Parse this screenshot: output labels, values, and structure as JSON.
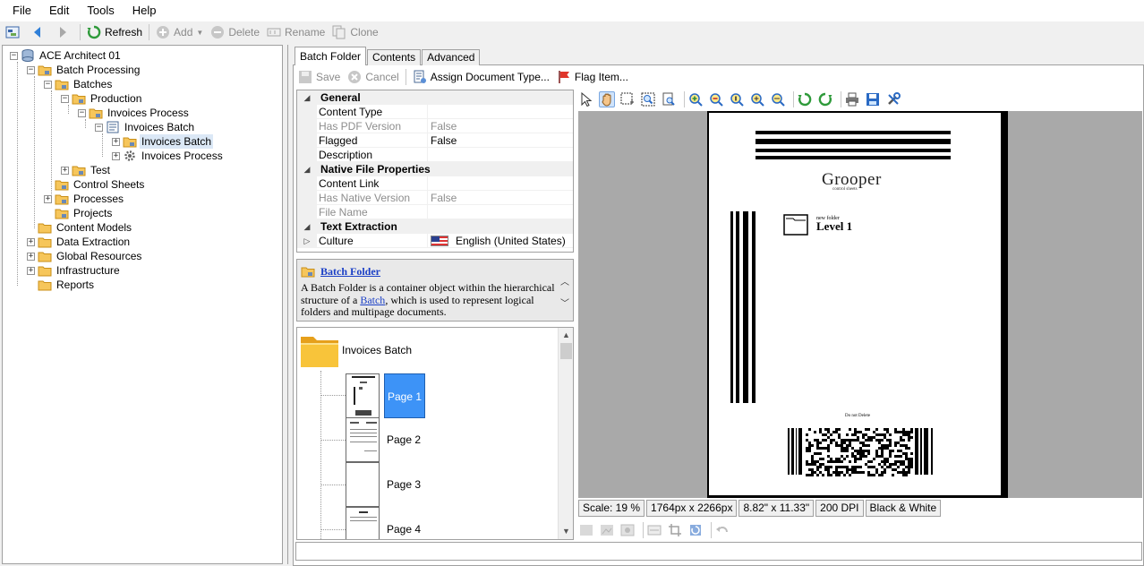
{
  "menu": [
    "File",
    "Edit",
    "Tools",
    "Help"
  ],
  "main_toolbar": {
    "refresh": "Refresh",
    "add": "Add",
    "delete": "Delete",
    "rename": "Rename",
    "clone": "Clone"
  },
  "tree": {
    "root": "ACE Architect 01",
    "batch_processing": "Batch Processing",
    "batches": "Batches",
    "production": "Production",
    "invoices_process_folder": "Invoices Process",
    "invoices_batch_node": "Invoices Batch",
    "invoices_batch_selected": "Invoices Batch",
    "invoices_process_item": "Invoices Process",
    "test": "Test",
    "control_sheets": "Control Sheets",
    "processes": "Processes",
    "projects": "Projects",
    "content_models": "Content Models",
    "data_extraction": "Data Extraction",
    "global_resources": "Global Resources",
    "infrastructure": "Infrastructure",
    "reports": "Reports"
  },
  "tabs": [
    "Batch Folder",
    "Contents",
    "Advanced"
  ],
  "action_toolbar": {
    "save": "Save",
    "cancel": "Cancel",
    "assign": "Assign Document Type...",
    "flag": "Flag Item..."
  },
  "properties": {
    "general": "General",
    "content_type": "Content Type",
    "has_pdf_version": "Has PDF Version",
    "has_pdf_version_value": "False",
    "flagged": "Flagged",
    "flagged_value": "False",
    "description": "Description",
    "native_file_properties": "Native File Properties",
    "content_link": "Content Link",
    "has_native_version": "Has Native Version",
    "has_native_version_value": "False",
    "file_name": "File Name",
    "text_extraction": "Text Extraction",
    "culture": "Culture",
    "culture_value": "English (United States)"
  },
  "help": {
    "title": "Batch Folder",
    "text_1": "A Batch Folder is a container object within the hierarchical structure of a ",
    "link": "Batch",
    "text_2": ", which is used to represent logical folders and multipage documents."
  },
  "pages_list": {
    "folder_name": "Invoices Batch",
    "pages": [
      "Page 1",
      "Page 2",
      "Page 3",
      "Page 4"
    ]
  },
  "document": {
    "logo": "Grooper",
    "logo_sub": "control sheets",
    "folder_caption": "new folder",
    "level": "Level 1",
    "footer": "Do not Delete"
  },
  "status_bar": {
    "scale": "Scale: 19 %",
    "pixels": "1764px x 2266px",
    "inches": "8.82\" x 11.33\"",
    "dpi": "200 DPI",
    "color": "Black & White"
  }
}
